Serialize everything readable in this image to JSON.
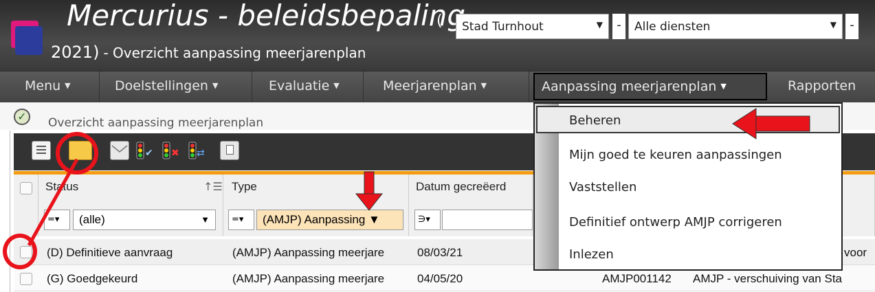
{
  "header": {
    "app_title": "Mercurius - beleidsbepaling",
    "paren_open": "(",
    "org_select": "Stad Turnhout",
    "dash": "-",
    "dept_select": "Alle diensten",
    "dash2": "-",
    "year": "2021)",
    "subtitle": "- Overzicht aanpassing meerjarenplan"
  },
  "nav": {
    "items": [
      {
        "label": "Menu"
      },
      {
        "label": "Doelstellingen"
      },
      {
        "label": "Evaluatie"
      },
      {
        "label": "Meerjarenplan"
      },
      {
        "label": "Aanpassing meerjarenplan"
      },
      {
        "label": "Rapporten"
      }
    ]
  },
  "page": {
    "title": "Overzicht aanpassing meerjarenplan"
  },
  "dropdown": {
    "items": [
      {
        "label": "Beheren"
      },
      {
        "label": "Mijn goed te keuren aanpassingen"
      },
      {
        "label": "Vaststellen"
      },
      {
        "label": "Definitief ontwerp AMJP corrigeren"
      },
      {
        "label": "Inlezen"
      }
    ]
  },
  "grid": {
    "columns": {
      "status": "Status",
      "type": "Type",
      "datum": "Datum gecreëerd"
    },
    "filters": {
      "status_op": "=▾",
      "status_val": "(alle)",
      "type_op": "=▾",
      "type_val": "(AMJP) Aanpassing ▼",
      "datum_op": "∋▾"
    },
    "rows": [
      {
        "status": "(D) Definitieve aanvraag",
        "type": "(AMJP) Aanpassing meerjare",
        "datum": "08/03/21",
        "code": "",
        "desc": "voor"
      },
      {
        "status": "(G) Goedgekeurd",
        "type": "(AMJP) Aanpassing meerjare",
        "datum": "04/05/20",
        "code": "AMJP001142",
        "desc": "AMJP - verschuiving van Sta"
      }
    ]
  },
  "colors": {
    "accent_orange": "#f39c12",
    "annotation_red": "#e8131b"
  }
}
